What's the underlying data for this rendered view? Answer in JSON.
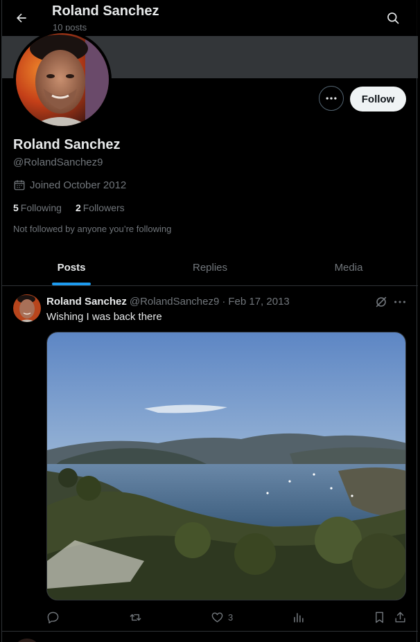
{
  "header": {
    "title": "Roland Sanchez",
    "subtitle": "10 posts",
    "back_icon": "arrow-left-icon",
    "search_icon": "search-icon"
  },
  "profile": {
    "name": "Roland Sanchez",
    "handle": "@RolandSanchez9",
    "joined": "Joined October 2012",
    "following_count": "5",
    "following_label": "Following",
    "followers_count": "2",
    "followers_label": "Followers",
    "not_followed_text": "Not followed by anyone you’re following",
    "follow_button": "Follow"
  },
  "tabs": [
    {
      "label": "Posts",
      "active": true
    },
    {
      "label": "Replies",
      "active": false
    },
    {
      "label": "Media",
      "active": false
    }
  ],
  "tweet": {
    "name": "Roland Sanchez",
    "handle": "@RolandSanchez9",
    "separator": "·",
    "date": "Feb 17, 2013",
    "text": "Wishing I was back there",
    "likes": "3"
  },
  "colors": {
    "accent": "#1d9bf0",
    "background": "#000000",
    "secondary_text": "#71767b",
    "banner": "#333639"
  }
}
